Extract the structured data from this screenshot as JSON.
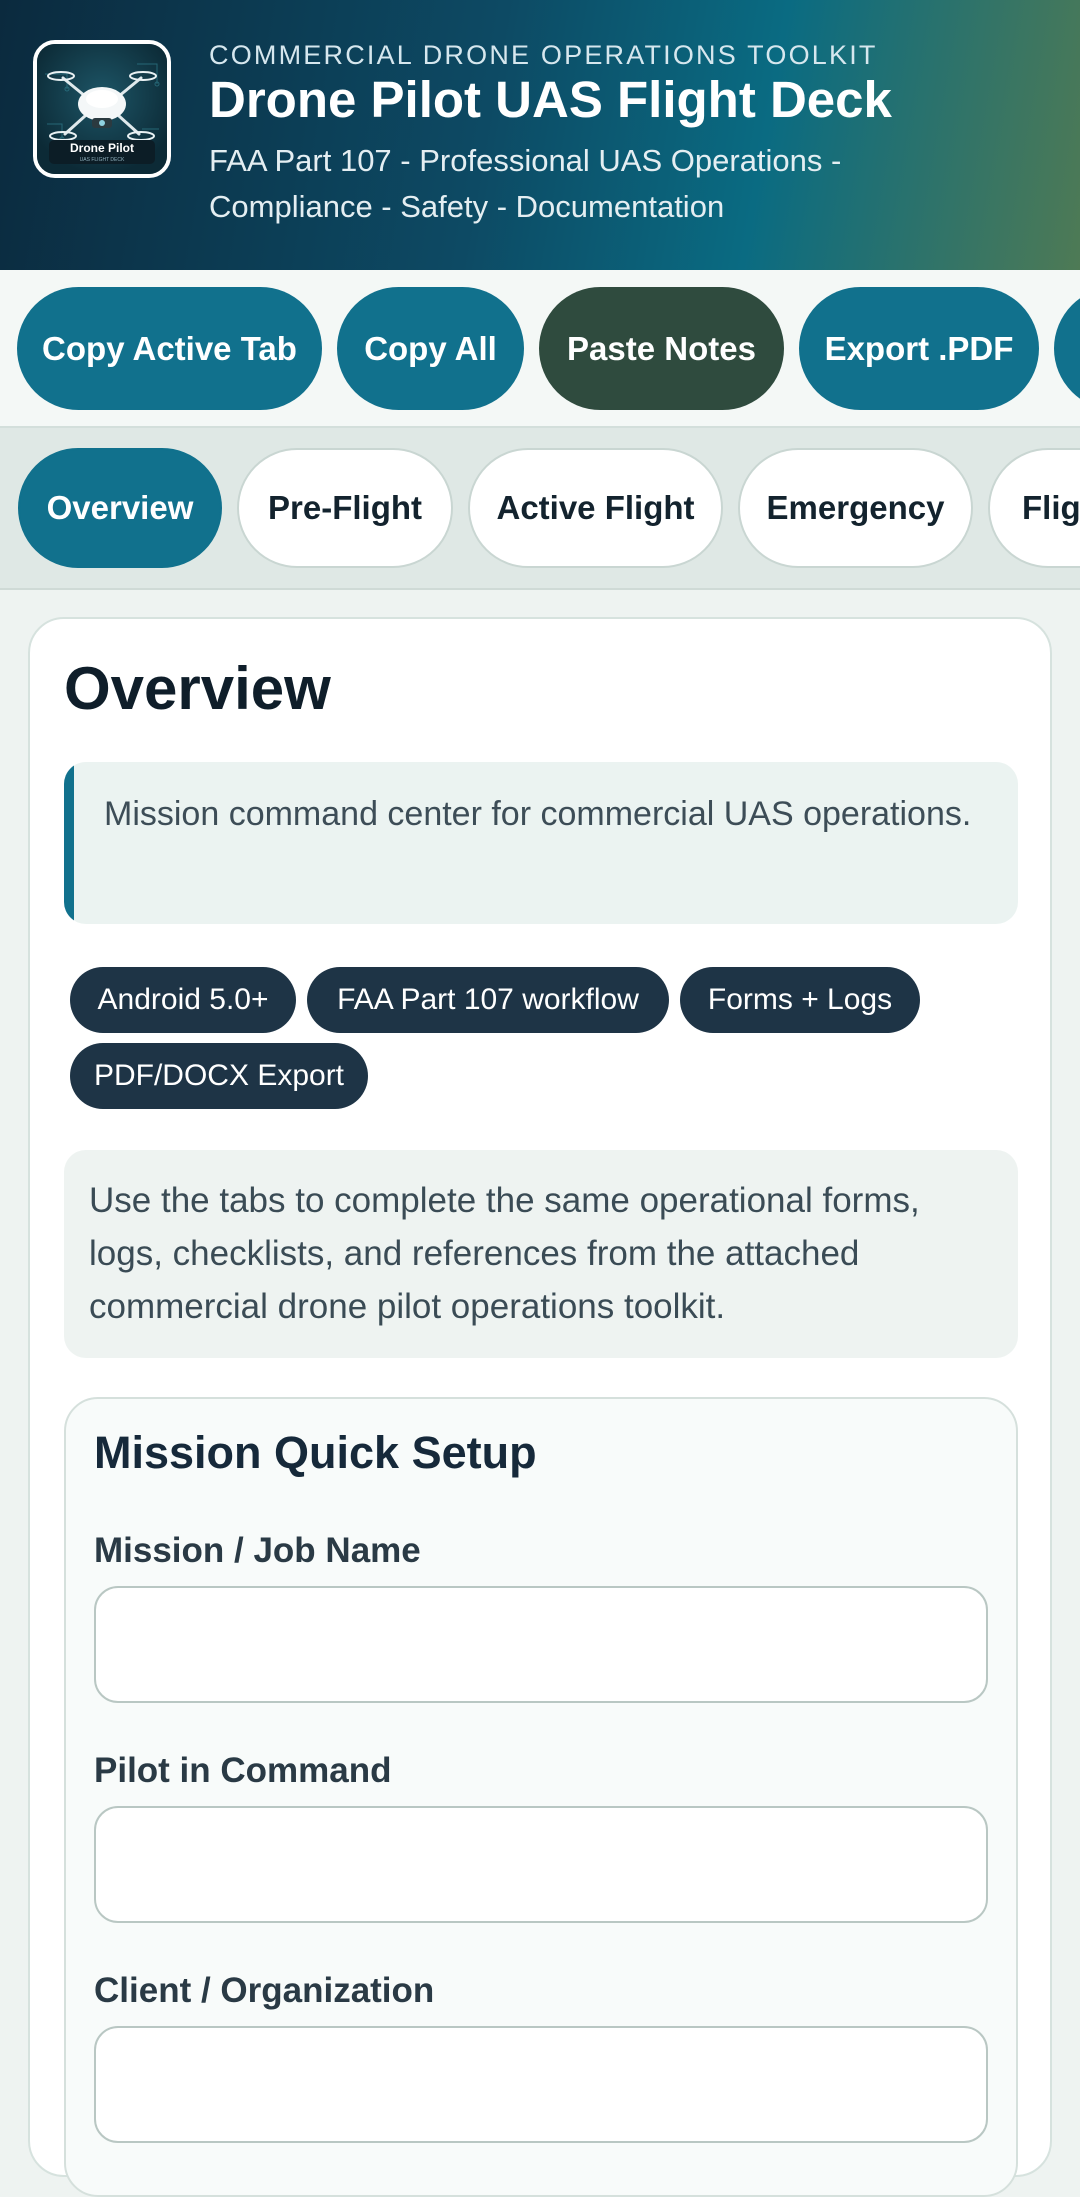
{
  "header": {
    "kicker": "COMMERCIAL DRONE OPERATIONS TOOLKIT",
    "title": "Drone Pilot UAS Flight Deck",
    "subtitle": "FAA Part 107 - Professional UAS Operations - Compliance - Safety - Documentation",
    "logo": {
      "icon": "drone-icon",
      "caption": "Drone Pilot",
      "tagline": "UAS FLIGHT DECK"
    }
  },
  "actions": [
    {
      "label": "Copy Active Tab"
    },
    {
      "label": "Copy All"
    },
    {
      "label": "Paste Notes"
    },
    {
      "label": "Export .PDF"
    },
    {
      "label": ""
    }
  ],
  "tabs": [
    {
      "label": "Overview",
      "active": true
    },
    {
      "label": "Pre-Flight"
    },
    {
      "label": "Active Flight"
    },
    {
      "label": "Emergency"
    },
    {
      "label": "Fligh"
    }
  ],
  "overview": {
    "title": "Overview",
    "callout": "Mission command center for commercial UAS operations.",
    "chips": [
      "Android 5.0+",
      "FAA Part 107 workflow",
      "Forms + Logs",
      "PDF/DOCX Export"
    ],
    "info": "Use the tabs to complete the same operational forms, logs, checklists, and references from the attached commercial drone pilot operations toolkit."
  },
  "mission_setup": {
    "title": "Mission Quick Setup",
    "fields": [
      {
        "label": "Mission / Job Name",
        "value": ""
      },
      {
        "label": "Pilot in Command",
        "value": ""
      },
      {
        "label": "Client / Organization",
        "value": ""
      }
    ]
  },
  "colors": {
    "primary": "#11718d",
    "paste_button": "#2f4b3e",
    "chip": "#1e3446",
    "header_dark": "#0b2a3e"
  }
}
